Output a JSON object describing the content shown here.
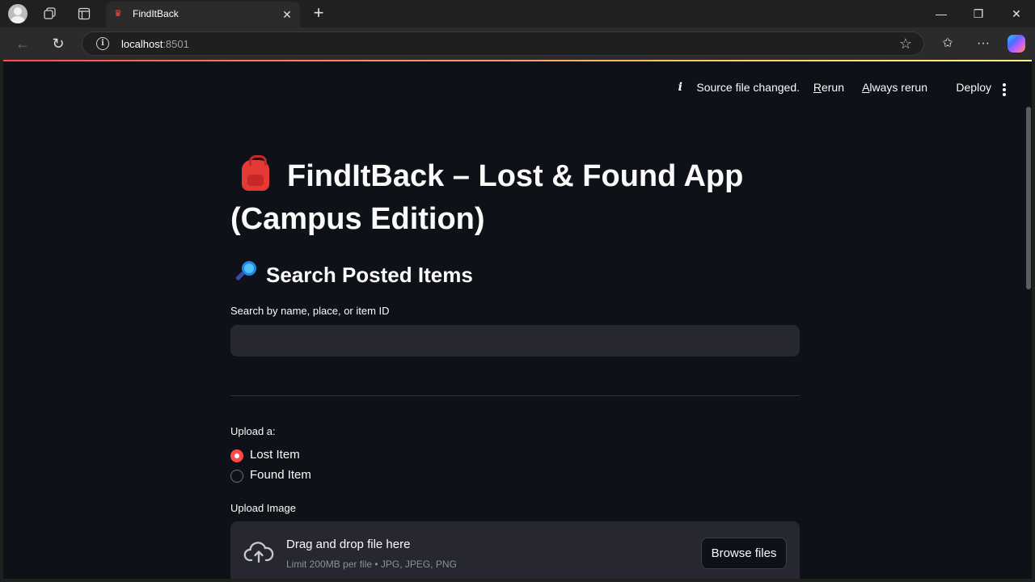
{
  "browser": {
    "tab_title": "FindItBack",
    "close_tab": "✕",
    "new_tab": "+",
    "url_host": "localhost",
    "url_port": ":8501",
    "window_min": "—",
    "window_restore": "❐",
    "window_close": "✕"
  },
  "toolbar": {
    "status_text": "Source file changed.",
    "rerun_label": "Rerun",
    "always_rerun_label": "Always rerun",
    "deploy_label": "Deploy"
  },
  "main": {
    "title": "FindItBack – Lost & Found App (Campus Edition)",
    "search_heading": "Search Posted Items",
    "search_label": "Search by name, place, or item ID",
    "search_value": "",
    "upload_type_label": "Upload a:",
    "radio_options": [
      {
        "label": "Lost Item",
        "selected": true
      },
      {
        "label": "Found Item",
        "selected": false
      }
    ],
    "upload_image_label": "Upload Image",
    "dropzone_title": "Drag and drop file here",
    "dropzone_limit": "Limit 200MB per file • JPG, JPEG, PNG",
    "browse_label": "Browse files"
  },
  "colors": {
    "accent": "#ff4b4b",
    "background": "#0e1117",
    "input_bg": "#262730"
  }
}
